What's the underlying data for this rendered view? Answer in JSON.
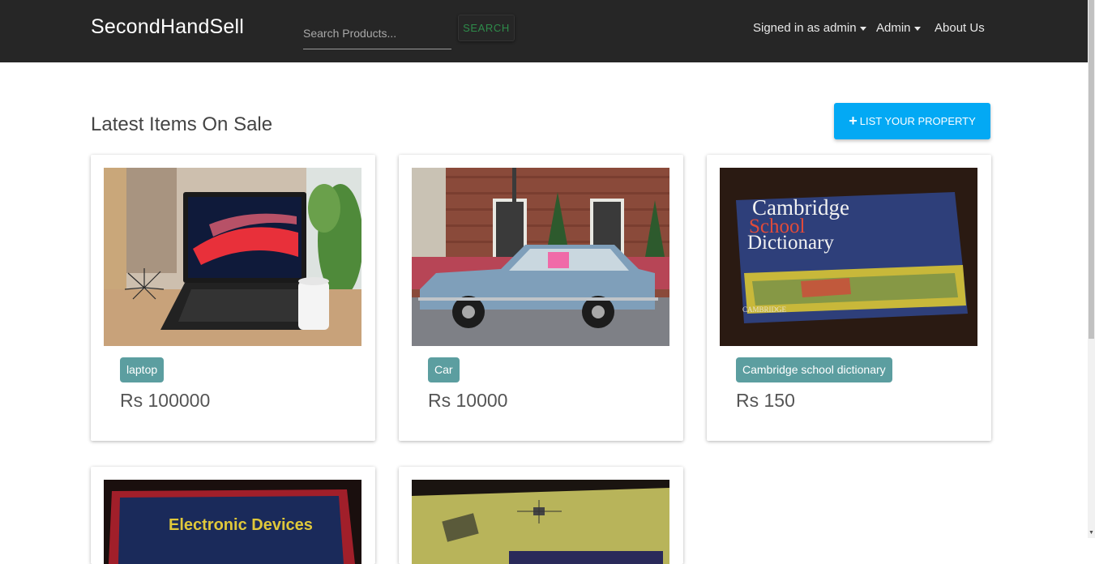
{
  "navbar": {
    "brand": "SecondHandSell",
    "search_placeholder": "Search Products...",
    "search_button": "SEARCH",
    "signed_in": "Signed in as admin",
    "admin": "Admin",
    "about": "About Us"
  },
  "main": {
    "heading": "Latest Items On Sale",
    "list_button": "LIST YOUR PROPERTY"
  },
  "items": [
    {
      "name": "laptop",
      "price": "Rs 100000"
    },
    {
      "name": "Car",
      "price": "Rs 10000"
    },
    {
      "name": "Cambridge school dictionary",
      "price": "Rs 150"
    },
    {
      "book_title": "Electronic Devices"
    },
    {}
  ],
  "colors": {
    "navbar": "#262626",
    "accent": "#03a9f4",
    "tag": "#5c9ea0"
  }
}
